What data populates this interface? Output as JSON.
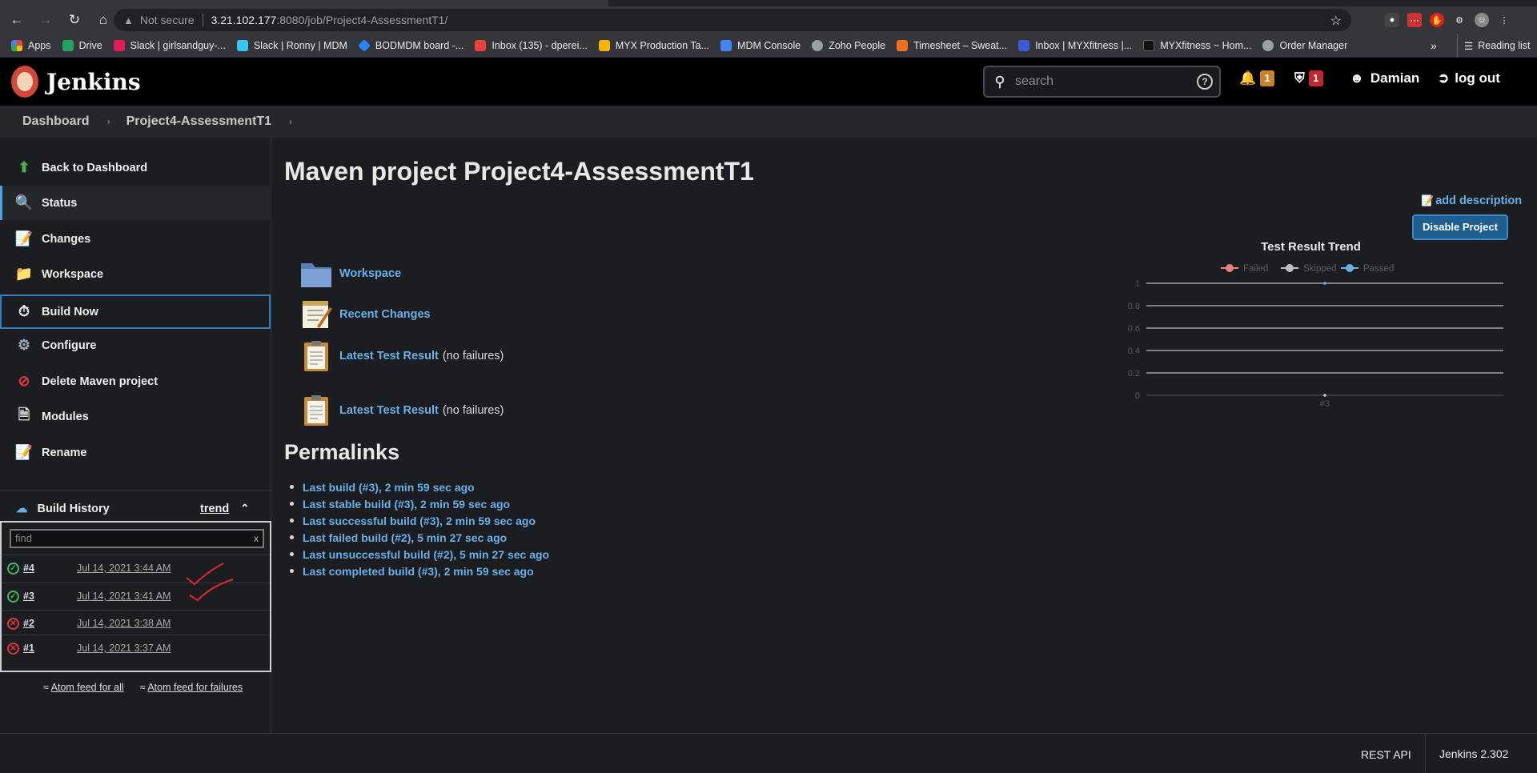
{
  "browser": {
    "security_label": "Not secure",
    "url_host": "3.21.102.177",
    "url_path": ":8080/job/Project4-AssessmentT1/",
    "bookmarks": [
      {
        "label": "Apps",
        "color": "#e8eaed"
      },
      {
        "label": "Drive",
        "color": "#1fa463"
      },
      {
        "label": "Slack | girlsandguy-...",
        "color": "#e01e5a"
      },
      {
        "label": "Slack | Ronny | MDM",
        "color": "#36c5f0"
      },
      {
        "label": "BODMDM board -...",
        "color": "#2684ff"
      },
      {
        "label": "Inbox (135) - dperei...",
        "color": "#ea4335"
      },
      {
        "label": "MYX Production Ta...",
        "color": "#f4b400"
      },
      {
        "label": "MDM Console",
        "color": "#4285f4"
      },
      {
        "label": "Zoho People",
        "color": "#9aa0a6"
      },
      {
        "label": "Timesheet – Sweat...",
        "color": "#f37021"
      },
      {
        "label": "Inbox | MYXfitness |...",
        "color": "#3b5bdb"
      },
      {
        "label": "MYXfitness ~ Hom...",
        "color": "#222222"
      },
      {
        "label": "Order Manager",
        "color": "#9aa0a6"
      }
    ],
    "bookmarks_more": "»",
    "reading_list": "Reading list"
  },
  "header": {
    "brand": "Jenkins",
    "search_placeholder": "search",
    "notifications_count": "1",
    "security_count": "1",
    "user": "Damian",
    "logout": "log out",
    "notif_color": "#c8832b",
    "security_color": "#c0282d"
  },
  "breadcrumb": [
    "Dashboard",
    "Project4-AssessmentT1"
  ],
  "sidebar": {
    "tasks": [
      {
        "label": "Back to Dashboard",
        "icon": "up-arrow-icon"
      },
      {
        "label": "Status",
        "icon": "search-icon"
      },
      {
        "label": "Changes",
        "icon": "notepad-icon"
      },
      {
        "label": "Workspace",
        "icon": "folder-icon"
      },
      {
        "label": "Build Now",
        "icon": "clock-play-icon"
      },
      {
        "label": "Configure",
        "icon": "gear-icon"
      },
      {
        "label": "Delete Maven project",
        "icon": "no-entry-icon"
      },
      {
        "label": "Modules",
        "icon": "document-icon"
      },
      {
        "label": "Rename",
        "icon": "notepad-icon"
      }
    ],
    "build_history": {
      "title": "Build History",
      "trend_label": "trend",
      "find_placeholder": "find",
      "find_clear": "x",
      "builds": [
        {
          "number": "#4",
          "date": "Jul 14, 2021 3:44 AM",
          "status": "success"
        },
        {
          "number": "#3",
          "date": "Jul 14, 2021 3:41 AM",
          "status": "success"
        },
        {
          "number": "#2",
          "date": "Jul 14, 2021 3:38 AM",
          "status": "failed"
        },
        {
          "number": "#1",
          "date": "Jul 14, 2021 3:37 AM",
          "status": "failed"
        }
      ],
      "feed_all": "Atom feed for all",
      "feed_failures": "Atom feed for failures"
    }
  },
  "main": {
    "title": "Maven project Project4-AssessmentT1",
    "add_description": "add description",
    "disable_button": "Disable Project",
    "links": [
      {
        "label": "Workspace",
        "note": "",
        "icon": "folder-icon"
      },
      {
        "label": "Recent Changes",
        "note": "",
        "icon": "notepad-icon"
      },
      {
        "label": "Latest Test Result",
        "note": "(no failures)",
        "icon": "clipboard-icon"
      },
      {
        "label": "Latest Test Result",
        "note": "(no failures)",
        "icon": "clipboard-icon"
      }
    ],
    "permalinks_title": "Permalinks",
    "permalinks": [
      "Last build (#3), 2 min 59 sec ago",
      "Last stable build (#3), 2 min 59 sec ago",
      "Last successful build (#3), 2 min 59 sec ago",
      "Last failed build (#2), 5 min 27 sec ago",
      "Last unsuccessful build (#2), 5 min 27 sec ago",
      "Last completed build (#3), 2 min 59 sec ago"
    ]
  },
  "chart_data": {
    "type": "line",
    "title": "Test Result Trend",
    "categories": [
      "#3"
    ],
    "series": [
      {
        "name": "Failed",
        "values": [
          0
        ],
        "color": "#f08080"
      },
      {
        "name": "Skipped",
        "values": [
          0
        ],
        "color": "#c0c0c0"
      },
      {
        "name": "Passed",
        "values": [
          1
        ],
        "color": "#6ab0e8"
      }
    ],
    "y_ticks": [
      "1",
      "0.8",
      "0.6",
      "0.4",
      "0.2",
      "0"
    ],
    "ylim": [
      0,
      1
    ],
    "grid": true,
    "legend_position": "top"
  },
  "footer": {
    "rest_api": "REST API",
    "version": "Jenkins 2.302"
  }
}
